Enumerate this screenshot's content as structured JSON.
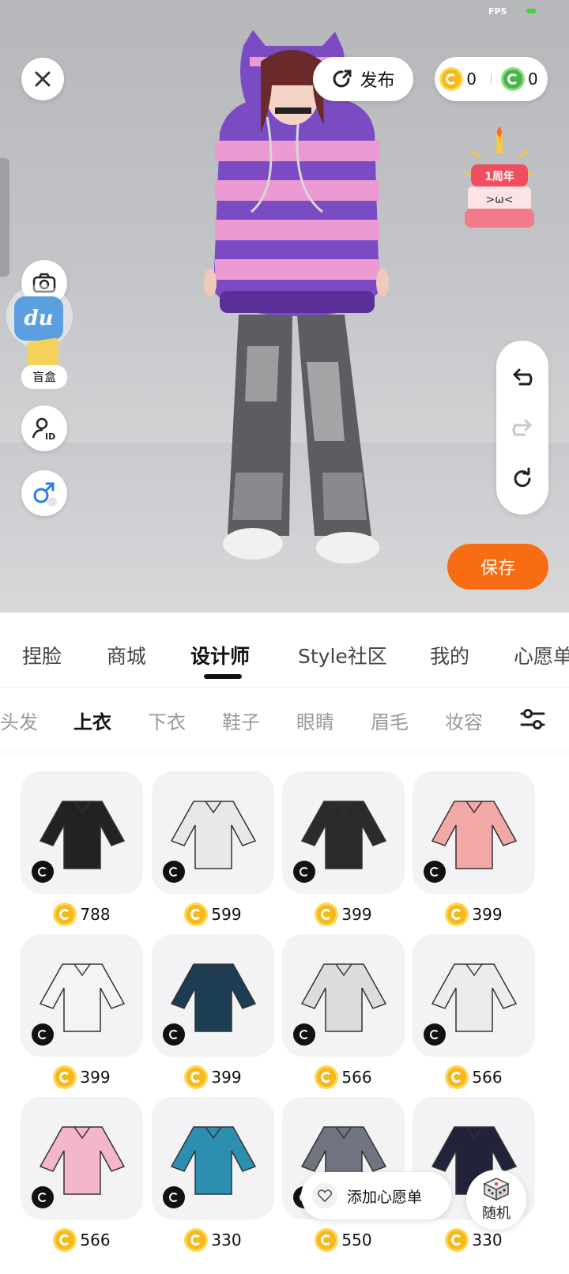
{
  "status": {
    "fps_label": "FPS"
  },
  "header": {
    "publish_label": "发布",
    "gold_coins": "0",
    "green_coins": "0"
  },
  "left_tools": {
    "blind_box_label": "盲盒",
    "app_logo_text": "du"
  },
  "event_badge": {
    "text": "1周年",
    "face": ">ω<"
  },
  "save_label": "保存",
  "main_tabs": [
    {
      "label": "捏脸"
    },
    {
      "label": "商城"
    },
    {
      "label": "设计师"
    },
    {
      "label": "Style社区"
    },
    {
      "label": "我的"
    },
    {
      "label": "心愿单"
    }
  ],
  "main_tabs_active": "设计师",
  "sub_tabs": [
    {
      "label": "头发"
    },
    {
      "label": "上衣"
    },
    {
      "label": "下衣"
    },
    {
      "label": "鞋子"
    },
    {
      "label": "眼睛"
    },
    {
      "label": "眉毛"
    },
    {
      "label": "妆容"
    }
  ],
  "sub_tabs_active": "上衣",
  "items": [
    {
      "price": "788",
      "color": "#222222"
    },
    {
      "price": "599",
      "color": "#e8e8e8"
    },
    {
      "price": "399",
      "color": "#2b2b2b"
    },
    {
      "price": "399",
      "color": "#f2a9a6"
    },
    {
      "price": "399",
      "color": "#f4f4f4"
    },
    {
      "price": "399",
      "color": "#1d3d52"
    },
    {
      "price": "566",
      "color": "#dcdcdc"
    },
    {
      "price": "566",
      "color": "#ececec"
    },
    {
      "price": "566",
      "color": "#f3b6cc"
    },
    {
      "price": "330",
      "color": "#2d8fb0"
    },
    {
      "price": "550",
      "color": "#6f7480"
    },
    {
      "price": "330",
      "color": "#22223a"
    }
  ],
  "wishlist_label": "添加心愿单",
  "random_label": "随机"
}
